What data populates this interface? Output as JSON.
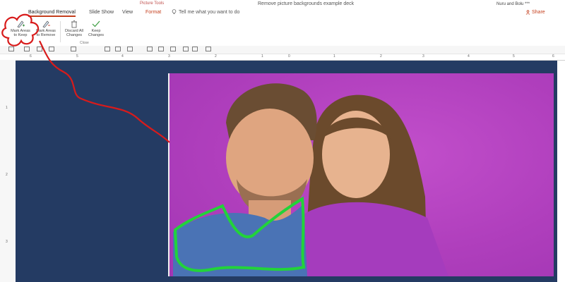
{
  "app": {
    "doc_title": "Remove picture backgrounds example deck",
    "contextual_group": "Picture Tools",
    "user_name": "Nuru and Bolu ***"
  },
  "tabs": [
    {
      "label": "Background Removal",
      "active": true
    },
    {
      "label": "Slide Show",
      "active": false
    },
    {
      "label": "View",
      "active": false
    },
    {
      "label": "Format",
      "active": false
    }
  ],
  "tell_me": {
    "placeholder": "Tell me what you want to do"
  },
  "share": {
    "label": "Share"
  },
  "ribbon": {
    "buttons": [
      {
        "label_line1": "Mark Areas",
        "label_line2": "to Keep"
      },
      {
        "label_line1": "Mark Areas",
        "label_line2": "to Remove"
      },
      {
        "label_line1": "Discard All",
        "label_line2": "Changes"
      },
      {
        "label_line1": "Keep",
        "label_line2": "Changes"
      }
    ],
    "group_label": "Close"
  },
  "ruler": {
    "ticks": [
      "6",
      "5",
      "4",
      "3",
      "2",
      "1",
      "0",
      "1",
      "2",
      "3",
      "4",
      "5",
      "6"
    ],
    "v_ticks": [
      "1",
      "2",
      "3"
    ]
  },
  "colors": {
    "accent": "#c43e1c",
    "slide_bg": "#243b63",
    "photo_bg": "#b844c4",
    "annotation": "#d81b1b",
    "keep_outline": "#22d33a"
  },
  "icons": [
    "pencil-plus-icon",
    "pencil-minus-icon",
    "trash-icon",
    "checkmark-icon",
    "lightbulb-icon",
    "share-icon"
  ]
}
